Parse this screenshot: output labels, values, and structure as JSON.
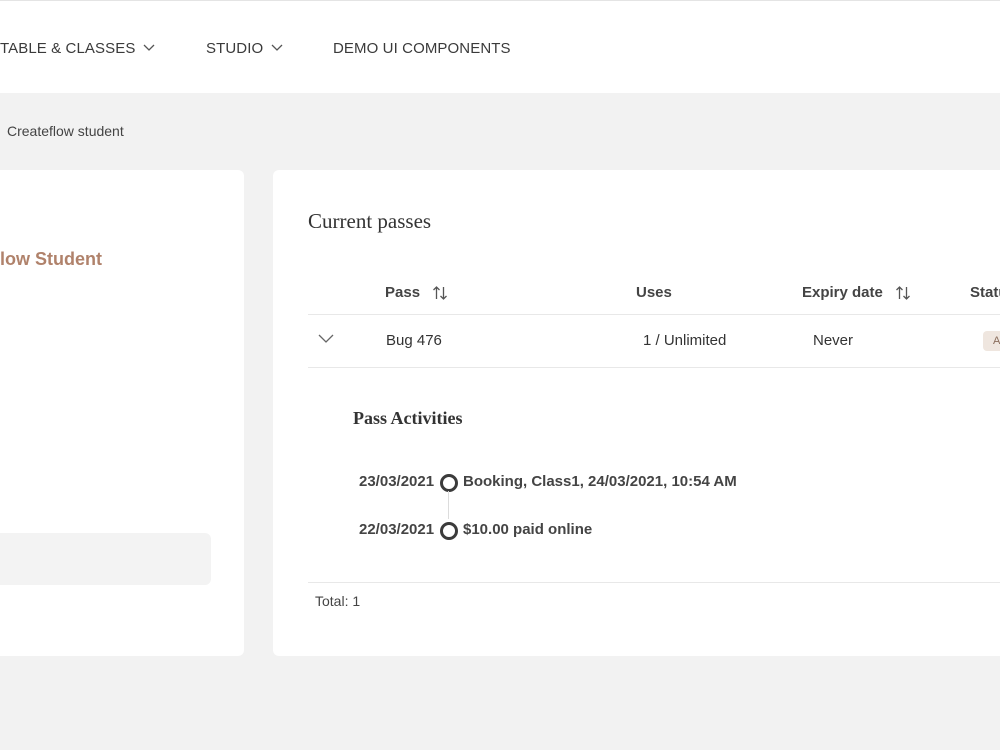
{
  "nav": {
    "items": [
      {
        "label": "TABLE & CLASSES",
        "has_dropdown": true
      },
      {
        "label": "STUDIO",
        "has_dropdown": true
      },
      {
        "label": "DEMO UI COMPONENTS",
        "has_dropdown": false
      }
    ]
  },
  "breadcrumb": {
    "current": "Createflow student"
  },
  "student": {
    "name": "low Student"
  },
  "passes": {
    "title": "Current passes",
    "columns": [
      {
        "label": "Pass",
        "sortable": true
      },
      {
        "label": "Uses",
        "sortable": false
      },
      {
        "label": "Expiry date",
        "sortable": true
      },
      {
        "label": "Statu",
        "sortable": false
      }
    ],
    "rows": [
      {
        "pass": "Bug 476",
        "uses": "1 / Unlimited",
        "expiry": "Never",
        "status": "A"
      }
    ],
    "activities_title": "Pass Activities",
    "activities": [
      {
        "date": "23/03/2021",
        "text": "Booking, Class1, 24/03/2021, 10:54 AM"
      },
      {
        "date": "22/03/2021",
        "text": "$10.00 paid online"
      }
    ],
    "total": "Total: 1"
  },
  "colors": {
    "accent": "#b0826b",
    "badge_bg": "#efe6df",
    "page_bg": "#f2f2f2"
  }
}
